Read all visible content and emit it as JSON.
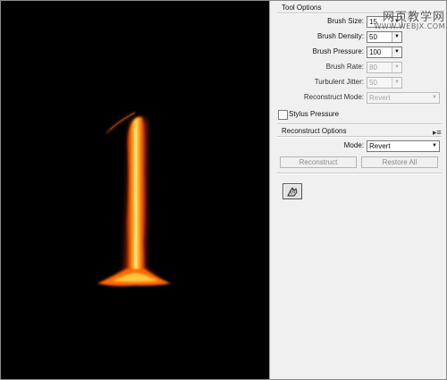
{
  "tool_options": {
    "title": "Tool Options",
    "brush_size": {
      "label": "Brush Size:",
      "value": "15"
    },
    "brush_density": {
      "label": "Brush Density:",
      "value": "50"
    },
    "brush_pressure": {
      "label": "Brush Pressure:",
      "value": "100"
    },
    "brush_rate": {
      "label": "Brush Rate:",
      "value": "80"
    },
    "turbulent_jitter": {
      "label": "Turbulent Jitter:",
      "value": "50"
    },
    "reconstruct_mode": {
      "label": "Reconstruct Mode:",
      "value": "Revert"
    },
    "stylus_pressure": {
      "label": "Stylus Pressure",
      "checked": false
    }
  },
  "reconstruct_options": {
    "title": "Reconstruct Options",
    "mode": {
      "label": "Mode:",
      "value": "Revert"
    },
    "reconstruct_button": "Reconstruct",
    "restore_all_button": "Restore All"
  },
  "watermark": {
    "line1": "网页教学网",
    "line2": "WWW.WEBJX.COM"
  },
  "icons": {
    "panel_menu": "panel-menu-icon",
    "tool": "hand-tool-icon",
    "dropdown": "chevron-down-icon"
  },
  "colors": {
    "canvas": "#000000",
    "panel": "#f0f0f0",
    "flame_core": "#ffd23a",
    "flame_edge": "#ff5a00"
  }
}
